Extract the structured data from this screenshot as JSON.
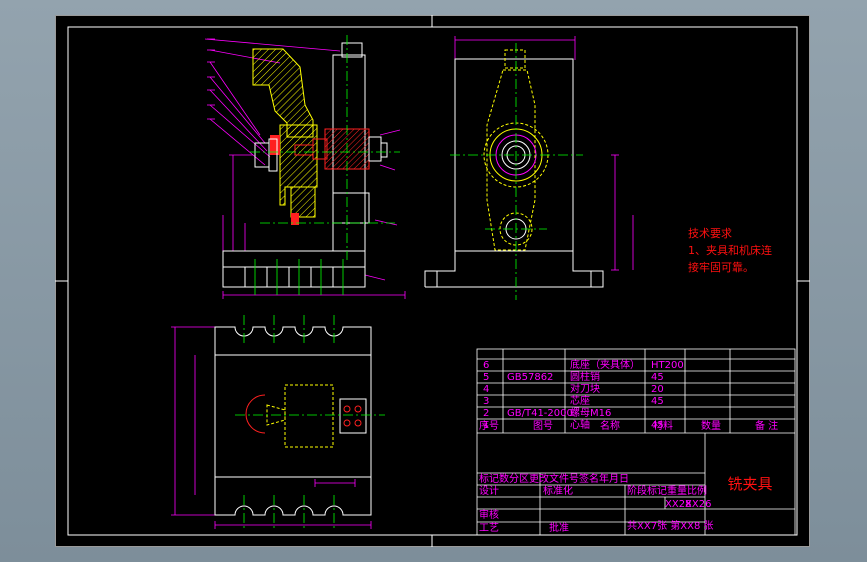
{
  "technical_requirements": {
    "heading": "技术要求",
    "line1": "1、夹具和机床连",
    "line2": "接牢固可靠。"
  },
  "parts_list": {
    "rows": [
      {
        "no": "6",
        "code": "",
        "name": "底座（夹具体）",
        "material": "HT200"
      },
      {
        "no": "5",
        "code": "GB57862",
        "name": "圆柱销",
        "material": "45"
      },
      {
        "no": "4",
        "code": "",
        "name": "对刀块",
        "material": "20"
      },
      {
        "no": "3",
        "code": "",
        "name": "芯座",
        "material": "45"
      },
      {
        "no": "2",
        "code": "GB/T41-2000",
        "name": "螺母M16",
        "material": ""
      },
      {
        "no": "1",
        "code": "",
        "name": "心轴",
        "material": "45"
      }
    ],
    "header": {
      "no": "序号",
      "code": "图号",
      "name": "名称",
      "material": "材料",
      "qty": "数量",
      "remark": "备 注"
    }
  },
  "title_block": {
    "row1": "标记数分区更改文件号签名年月日",
    "designer": "设计",
    "standardization": "标准化",
    "stage_label": "阶段标记重量比例",
    "review": "审核",
    "process": "工艺",
    "approve": "批准",
    "sheet_info": "共XX7张 第XX8 张",
    "code1": "XX28",
    "code2": "XX26",
    "drawing_title": "铣夹具"
  },
  "colors": {
    "background": "#000000",
    "frame": "#ffffff",
    "outline": "#ffffff",
    "hidden": "#ffff00",
    "center": "#00ff00",
    "dimension": "#ff00ff",
    "section": "#ff0000",
    "annotation": "#ff1010"
  }
}
